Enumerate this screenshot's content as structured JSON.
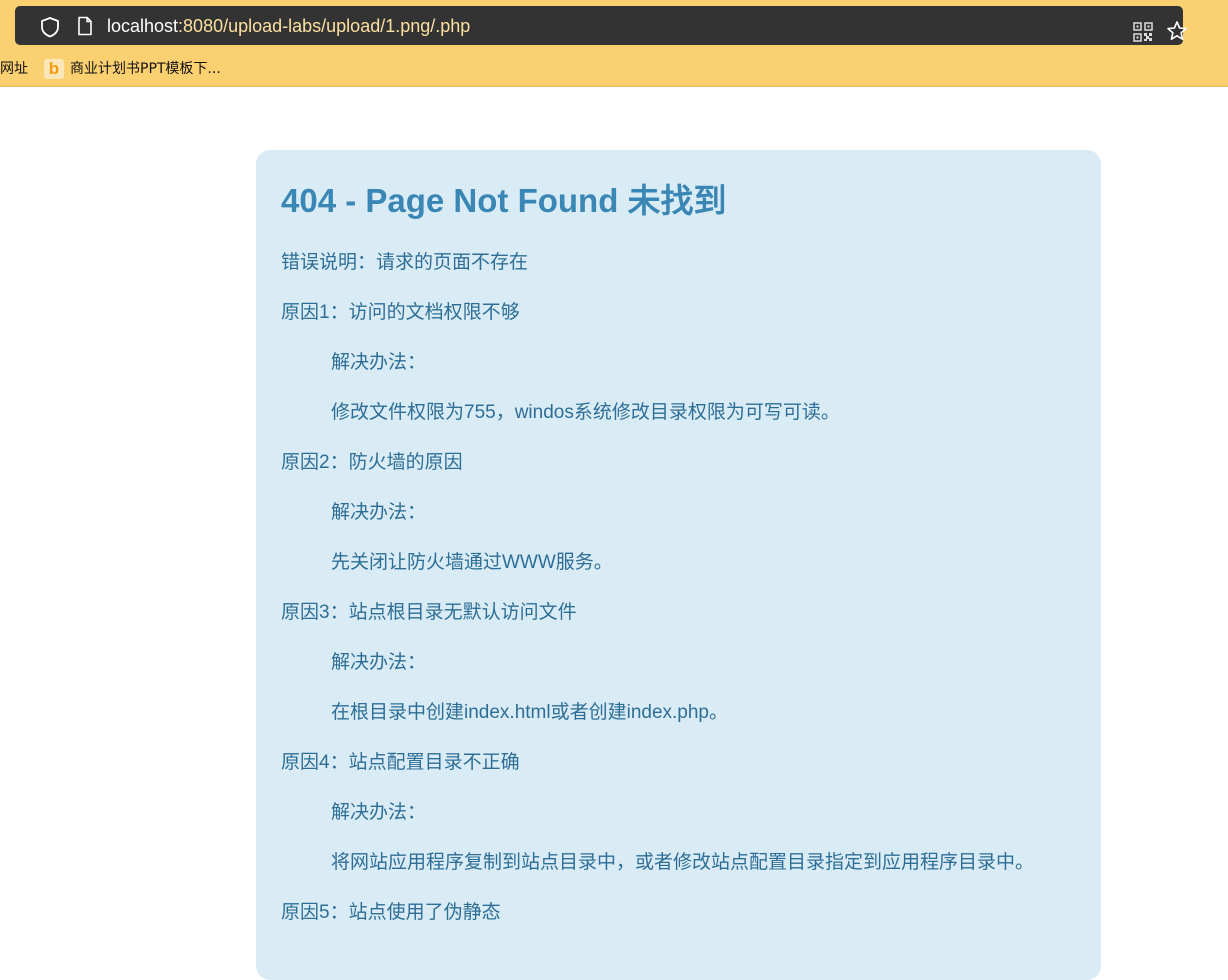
{
  "browser": {
    "url_host": "localhost",
    "url_rest": ":8080/upload-labs/upload/1.png/.php",
    "icons": {
      "shield": "shield-icon",
      "page": "page-icon",
      "qr": "qr-code-icon",
      "star": "star-icon"
    }
  },
  "bookmarks": {
    "item1": "网址",
    "item2_favicon": "b",
    "item2": "商业计划书PPT模板下..."
  },
  "content": {
    "title": "404 - Page Not Found 未找到",
    "lines": [
      "错误说明：请求的页面不存在",
      "原因1：访问的文档权限不够",
      "解决办法：",
      "修改文件权限为755，windos系统修改目录权限为可写可读。",
      "原因2：防火墙的原因",
      "解决办法：",
      "先关闭让防火墙通过WWW服务。",
      "原因3：站点根目录无默认访问文件",
      "解决办法：",
      "在根目录中创建index.html或者创建index.php。",
      "原因4：站点配置目录不正确",
      "解决办法：",
      "将网站应用程序复制到站点目录中，或者修改站点配置目录指定到应用程序目录中。",
      "原因5：站点使用了伪静态"
    ]
  },
  "colors": {
    "toolbar_bg": "#fbd070",
    "urlbar_bg": "#333333",
    "card_bg": "#d9ecf6",
    "title_color": "#3a86b4",
    "text_color": "#2e6e96"
  }
}
